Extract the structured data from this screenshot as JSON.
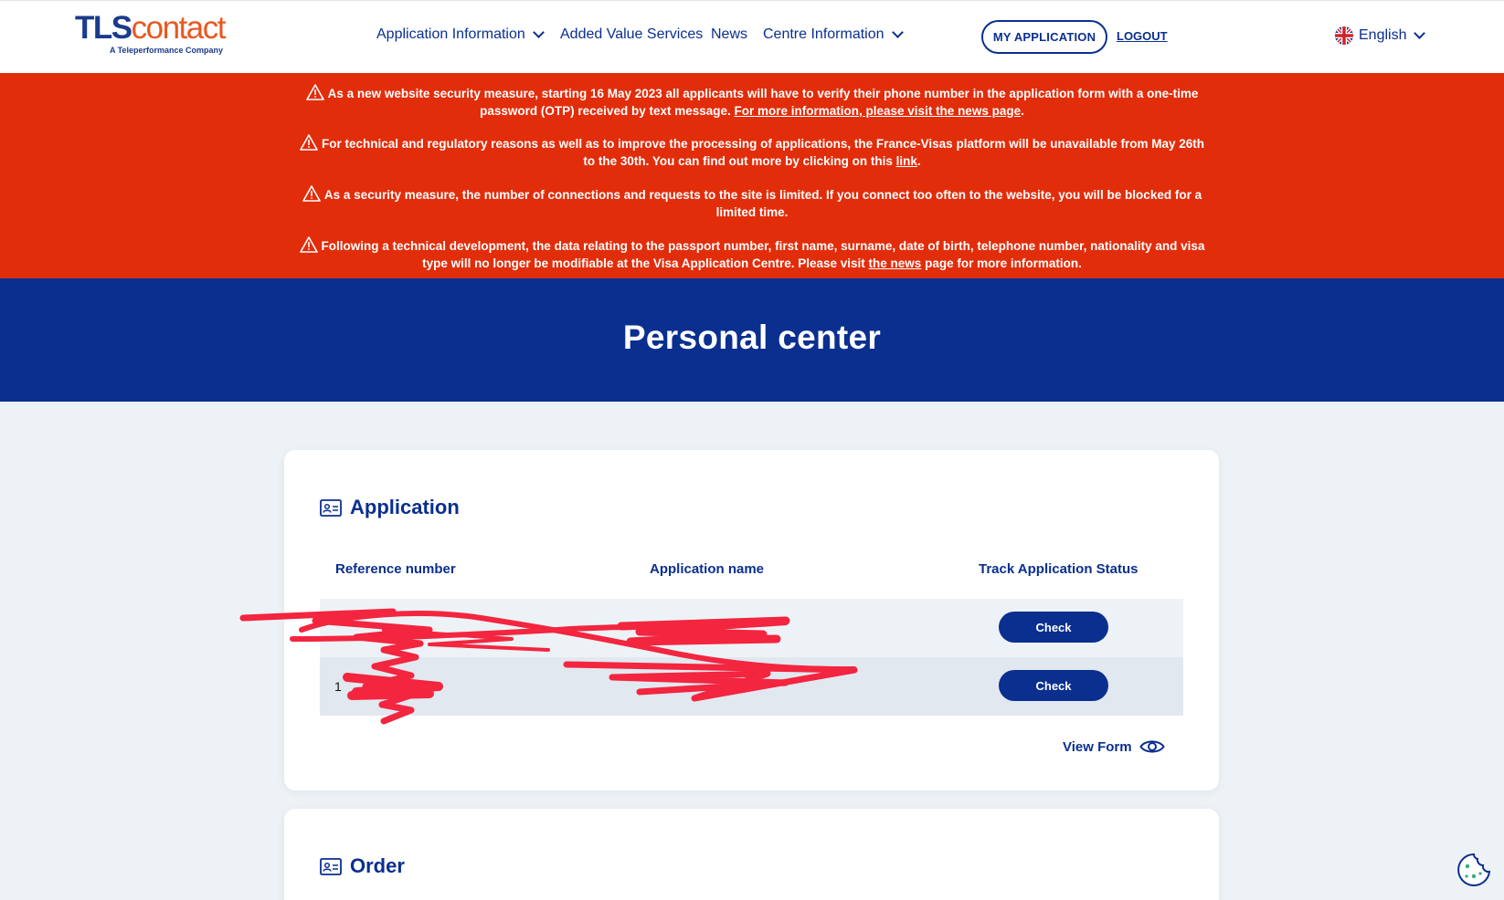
{
  "header": {
    "logo": {
      "wordmark_tls": "TLS",
      "wordmark_contact": "contact",
      "tagline": "A Teleperformance Company"
    },
    "nav": [
      {
        "label": "Application Information",
        "has_dropdown": true
      },
      {
        "label": "Added Value Services",
        "has_dropdown": false
      },
      {
        "label": "News",
        "has_dropdown": false
      },
      {
        "label": "Centre Information",
        "has_dropdown": true
      }
    ],
    "my_application_label": "MY APPLICATION",
    "logout_label": "LOGOUT",
    "language": {
      "label": "English",
      "flag_icon": "uk-flag-icon"
    }
  },
  "alerts": {
    "color": "#e22d0b",
    "items": [
      {
        "text": "As a new website security measure, starting 16 May 2023 all applicants will have to verify their phone number in the application form with a one-time password (OTP) received by text message.",
        "link": "For more information, please visit the news page",
        "after": "."
      },
      {
        "text": "For technical and regulatory reasons as well as to improve the processing of applications, the France-Visas platform will be unavailable from May 26th to the 30th. You can find out more by clicking on this",
        "link": "link",
        "after": "."
      },
      {
        "text": "As a security measure, the number of connections and requests to the site is limited. If you connect too often to the website, you will be blocked for a limited time.",
        "link": "",
        "after": ""
      },
      {
        "text": "Following a technical development, the data relating to the passport number, first name, surname, date of birth, telephone number, nationality and visa type will no longer be modifiable at the Visa Application Centre. Please visit",
        "link": "the news",
        "after": "page for more information."
      }
    ]
  },
  "title_band": {
    "title": "Personal center",
    "color": "#0a2f8f"
  },
  "application": {
    "heading": "Application",
    "columns": [
      "Reference number",
      "Application name",
      "Track Application Status"
    ],
    "rows": [
      {
        "reference": "",
        "name": "",
        "action": "Check"
      },
      {
        "reference": "1",
        "name": "",
        "action": "Check"
      }
    ],
    "view_form_label": "View Form"
  },
  "order": {
    "heading": "Order"
  }
}
